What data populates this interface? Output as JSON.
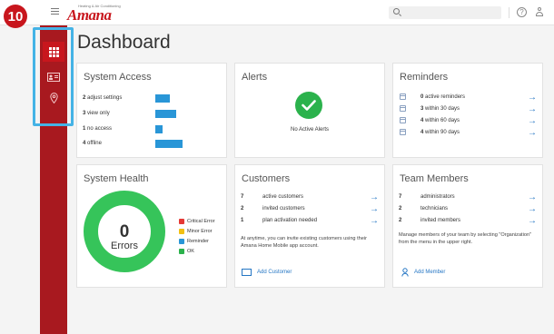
{
  "callout": "10",
  "brand": {
    "tagline": "Heating & Air Conditioning",
    "name": "Amana"
  },
  "page": {
    "title": "Dashboard"
  },
  "system_access": {
    "title": "System Access",
    "rows": [
      {
        "count": "2",
        "label": "adjust settings",
        "fraction": 0.35
      },
      {
        "count": "3",
        "label": "view only",
        "fraction": 0.5
      },
      {
        "count": "1",
        "label": "no access",
        "fraction": 0.18
      },
      {
        "count": "4",
        "label": "offline",
        "fraction": 0.65
      }
    ]
  },
  "alerts": {
    "title": "Alerts",
    "status": "No Active Alerts"
  },
  "reminders": {
    "title": "Reminders",
    "rows": [
      {
        "count": "0",
        "label": "active reminders"
      },
      {
        "count": "3",
        "label": "within 30 days"
      },
      {
        "count": "4",
        "label": "within 60 days"
      },
      {
        "count": "4",
        "label": "within 90 days"
      }
    ]
  },
  "system_health": {
    "title": "System Health",
    "count": "0",
    "count_label": "Errors",
    "legend": [
      {
        "label": "Critical Error",
        "color": "#e53935"
      },
      {
        "label": "Minor Error",
        "color": "#f2c012"
      },
      {
        "label": "Reminder",
        "color": "#2996d7"
      },
      {
        "label": "OK",
        "color": "#2bb24c"
      }
    ],
    "ring_color": "#36c45a"
  },
  "customers": {
    "title": "Customers",
    "rows": [
      {
        "count": "7",
        "label": "active customers"
      },
      {
        "count": "2",
        "label": "invited customers"
      },
      {
        "count": "1",
        "label": "plan activation needed"
      }
    ],
    "note": "At anytime, you can invite existing customers using their Amana Home Mobile app account.",
    "action": "Add Customer"
  },
  "team_members": {
    "title": "Team Members",
    "rows": [
      {
        "count": "7",
        "label": "administrators"
      },
      {
        "count": "2",
        "label": "technicians"
      },
      {
        "count": "2",
        "label": "invited members"
      }
    ],
    "note": "Manage members of your team by selecting \"Organization\" from the menu in the upper right.",
    "action": "Add Member"
  },
  "colors": {
    "brand_red": "#c8161d",
    "sidebar": "#a8191f",
    "accent_blue": "#2996d7",
    "highlight": "#45b3e6"
  },
  "icons": {
    "arrow": "→",
    "nav": [
      "dashboard-grid-icon",
      "customer-card-icon",
      "location-pin-icon"
    ]
  }
}
